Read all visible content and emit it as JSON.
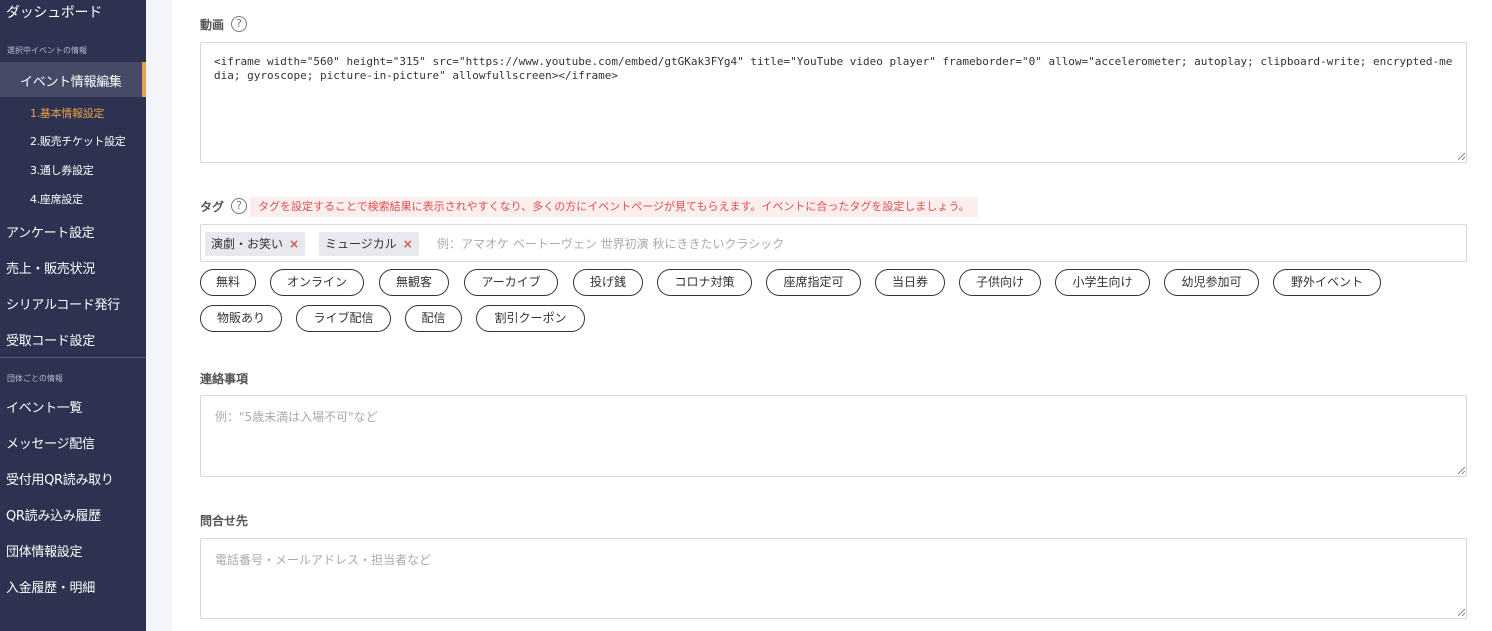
{
  "sidebar": {
    "dashboard": "ダッシュボード",
    "section_event": "選択中イベントの情報",
    "event_edit": "イベント情報編集",
    "sub_items": [
      "1.基本情報設定",
      "2.販売チケット設定",
      "3.通し券設定",
      "4.座席設定"
    ],
    "event_items": [
      "アンケート設定",
      "売上・販売状況",
      "シリアルコード発行",
      "受取コード設定"
    ],
    "section_group": "団体ごとの情報",
    "group_items": [
      "イベント一覧",
      "メッセージ配信",
      "受付用QR読み取り",
      "QR読み込み履歴",
      "団体情報設定",
      "入金履歴・明細"
    ]
  },
  "fields": {
    "video": {
      "label": "動画",
      "value": "<iframe width=\"560\" height=\"315\" src=\"https://www.youtube.com/embed/gtGKak3FYg4\" title=\"YouTube video player\" frameborder=\"0\" allow=\"accelerometer; autoplay; clipboard-write; encrypted-media; gyroscope; picture-in-picture\" allowfullscreen></iframe>"
    },
    "tags": {
      "label": "タグ",
      "hint": "タグを設定することで検索結果に表示されやすくなり、多くの方にイベントページが見てもらえます。イベントに合ったタグを設定しましょう。",
      "selected": [
        "演劇・お笑い",
        "ミュージカル"
      ],
      "remove_glyph": "×",
      "placeholder": "例：アマオケ ベートーヴェン 世界初演 秋にききたいクラシック",
      "suggestions": [
        "無料",
        "オンライン",
        "無観客",
        "アーカイブ",
        "投げ銭",
        "コロナ対策",
        "座席指定可",
        "当日券",
        "子供向け",
        "小学生向け",
        "幼児参加可",
        "野外イベント",
        "物販あり",
        "ライブ配信",
        "配信",
        "割引クーポン"
      ]
    },
    "notes": {
      "label": "連絡事項",
      "placeholder": "例：\"5歳未満は入場不可\"など"
    },
    "contact": {
      "label": "問合せ先",
      "placeholder": "電話番号・メールアドレス・担当者など"
    },
    "help_glyph": "?"
  },
  "colors": {
    "sidebar_bg": "#2d3250",
    "accent": "#e8a04a",
    "hint_text": "#e05050",
    "hint_bg": "#fbeeee",
    "chip_remove": "#d9534f"
  }
}
